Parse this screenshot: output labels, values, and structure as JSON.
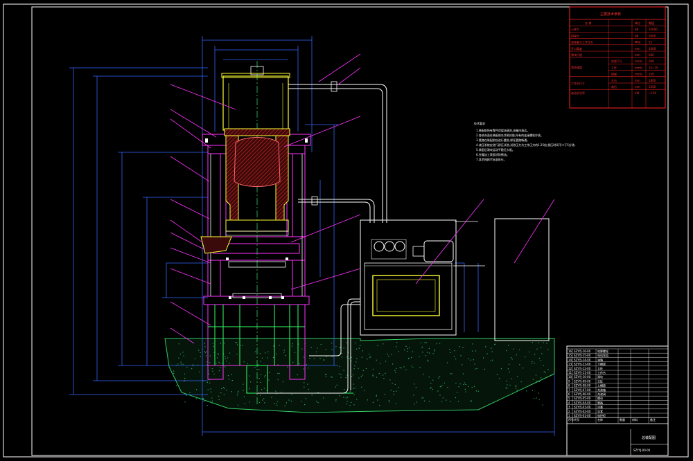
{
  "spec_table": {
    "title": "主要技术参数",
    "header": [
      "名 称",
      "单位",
      "数值"
    ],
    "rows": [
      {
        "name": "公称力",
        "unit": "kN",
        "value": "10000"
      },
      {
        "name": "回程力",
        "unit": "kN",
        "value": "2000"
      },
      {
        "name": "液体最大工作压力",
        "unit": "MPa",
        "value": "25"
      },
      {
        "name": "开口高度",
        "unit": "mm",
        "value": "1600"
      },
      {
        "name": "滑块行程",
        "unit": "mm",
        "value": "600"
      }
    ],
    "speed_group": "滑块速度",
    "speed_rows": [
      {
        "name": "空程下行",
        "unit": "mm/s",
        "value": "300"
      },
      {
        "name": "工作",
        "unit": "mm/s",
        "value": "15~25"
      },
      {
        "name": "回程",
        "unit": "mm/s",
        "value": "150"
      }
    ],
    "table_group": "工作台尺寸",
    "table_rows": [
      {
        "name": "左右",
        "unit": "mm",
        "value": "1800"
      },
      {
        "name": "前后",
        "unit": "mm",
        "value": "1200"
      }
    ],
    "motor_row": {
      "name": "电动机功率",
      "unit": "kW",
      "value": "~150"
    }
  },
  "notes": {
    "heading": "技术要求",
    "lines": [
      "1.装配前所有零件用煤油清洗,油箱内清洁。",
      "2.各结合面在装配前先涂密封胶,所有的连接螺栓拧紧。",
      "3.管路在装配前应进行酸洗,保证管路畅通。",
      "4.液压系统应进行耐压试验,试验压力为工作压力的1.25倍,保压时间不少于5分钟。",
      "5.装配后滑块运动平稳无卡阻。",
      "6.外露加工表面涂防锈油。",
      "7.其余按JB/T标准执行。"
    ]
  },
  "title_block": {
    "drawing_title": "总装配图",
    "drawing_number": "SZYYJ-00-00",
    "bom_rows": [
      {
        "no": "16",
        "code": "SZYYJ-16-00",
        "name": "地脚螺栓"
      },
      {
        "no": "15",
        "code": "SZYYJ-15-00",
        "name": "电机泵组"
      },
      {
        "no": "14",
        "code": "SZYYJ-14-00",
        "name": "油箱"
      },
      {
        "no": "13",
        "code": "SZYYJ-13-00",
        "name": "下横梁"
      },
      {
        "no": "12",
        "code": "SZYYJ-12-00",
        "name": "立柱"
      },
      {
        "no": "11",
        "code": "SZYYJ-11-00",
        "name": "工作台"
      },
      {
        "no": "10",
        "code": "SZYYJ-10-00",
        "name": "滑块"
      },
      {
        "no": "9",
        "code": "SZYYJ-09-00",
        "name": "主缸"
      },
      {
        "no": "8",
        "code": "SZYYJ-08-00",
        "name": "上横梁"
      },
      {
        "no": "7",
        "code": "SZYYJ-07-00",
        "name": "充液箱"
      },
      {
        "no": "6",
        "code": "SZYYJ-06-00",
        "name": "充液阀"
      },
      {
        "no": "5",
        "code": "SZYYJ-05-00",
        "name": "螺母"
      },
      {
        "no": "4",
        "code": "SZYYJ-04-00",
        "name": "管路"
      },
      {
        "no": "3",
        "code": "SZYYJ-03-00",
        "name": "活塞"
      },
      {
        "no": "2",
        "code": "SZYYJ-02-00",
        "name": "导套"
      },
      {
        "no": "1",
        "code": "SZYYJ-01-00",
        "name": "电控柜"
      }
    ],
    "bom_header": [
      "序号",
      "代号",
      "名称",
      "数量",
      "材料",
      "备注"
    ]
  },
  "colors": {
    "frame": "#ffffff",
    "outline": "#ff33ff",
    "dimension": "#3366ff",
    "pipe": "#ffffff",
    "ground": "#33cc66",
    "section": "#cc2222",
    "cylinder": "#ffff33",
    "table_border": "#ff2222"
  }
}
